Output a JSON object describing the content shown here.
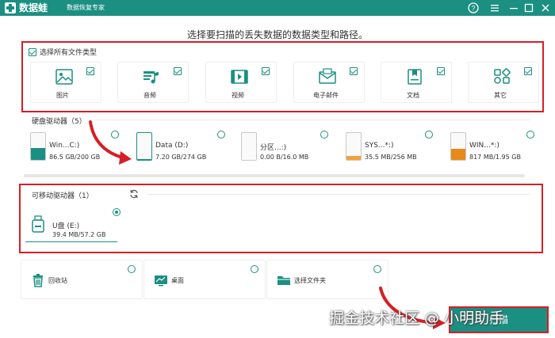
{
  "app": {
    "name": "数据蛙",
    "subtitle": "数据恢复专家",
    "icons": [
      "logo-icon",
      "help-icon",
      "menu-icon",
      "minimize-icon",
      "maximize-icon",
      "close-icon"
    ]
  },
  "instruction": "选择要扫描的丢失数据的数据类型和路径。",
  "file_types": {
    "select_all_label": "选择所有文件类型",
    "items": [
      {
        "label": "图片",
        "icon": "image-icon",
        "checked": true
      },
      {
        "label": "音频",
        "icon": "audio-icon",
        "checked": true
      },
      {
        "label": "视频",
        "icon": "video-icon",
        "checked": true
      },
      {
        "label": "电子邮件",
        "icon": "email-icon",
        "checked": true
      },
      {
        "label": "文档",
        "icon": "document-icon",
        "checked": true
      },
      {
        "label": "其它",
        "icon": "other-icon",
        "checked": true
      }
    ]
  },
  "hard_drives": {
    "title": "硬盘驱动器（5）",
    "items": [
      {
        "name": "Win...C:)",
        "size": "86.5 GB/200 GB",
        "used": 0.43,
        "color": "#1b8f82"
      },
      {
        "name": "Data (D:)",
        "size": "7.20 GB/274 GB",
        "used": 0.03,
        "color": "#1b8f82"
      },
      {
        "name": "分区...:)",
        "size": "0.00  B/16.0 MB",
        "used": 0.0,
        "color": "#f2a23a"
      },
      {
        "name": "SYS...*:)",
        "size": "35.5 MB/256 MB",
        "used": 0.14,
        "color": "#f2a23a"
      },
      {
        "name": "WIN...*:)",
        "size": "817 MB/1.95 GB",
        "used": 0.42,
        "color": "#e8891c"
      }
    ]
  },
  "removable": {
    "title": "可移动驱动器（1）",
    "refresh_icon": "refresh-icon",
    "items": [
      {
        "name": "U盘 (E:)",
        "size": "39.4 MB/57.2 GB",
        "selected": true
      }
    ]
  },
  "locations": [
    {
      "label": "回收站",
      "icon": "recycle-bin-icon"
    },
    {
      "label": "桌面",
      "icon": "desktop-icon"
    },
    {
      "label": "选择文件夹",
      "icon": "folder-icon"
    }
  ],
  "scan_button": "扫描",
  "watermark": "掘金技术社区 @ 小明助手",
  "colors": {
    "accent": "#1b8f82",
    "highlight": "#d61f26"
  }
}
